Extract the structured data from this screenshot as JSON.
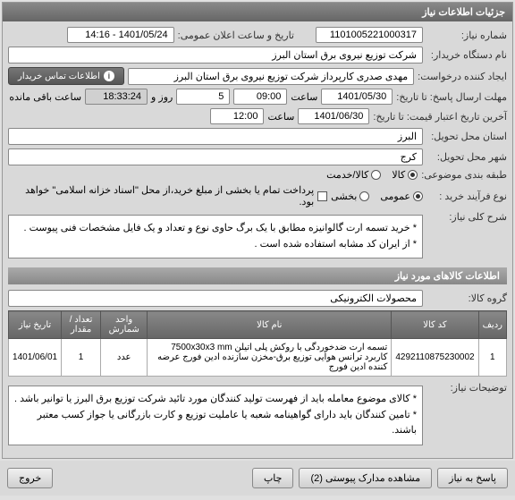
{
  "header": {
    "title": "جزئیات اطلاعات نیاز"
  },
  "fields": {
    "need_no_label": "شماره نیاز:",
    "need_no": "1101005221000317",
    "announce_label": "تاریخ و ساعت اعلان عمومی:",
    "announce_value": "1401/05/24 - 14:16",
    "buyer_label": "نام دستگاه خریدار:",
    "buyer": "شرکت توزیع نیروی برق استان البرز",
    "requester_label": "ایجاد کننده درخواست:",
    "requester": "مهدی صدری کارپرداز شرکت توزیع نیروی برق استان البرز",
    "contact_btn": "اطلاعات تماس خریدار",
    "deadline_label": "مهلت ارسال پاسخ: تا تاریخ:",
    "deadline_date": "1401/05/30",
    "time_label": "ساعت",
    "deadline_time": "09:00",
    "day_label": "روز و",
    "days_remaining": "5",
    "remaining_time": "18:33:24",
    "remaining_suffix": "ساعت باقی مانده",
    "validity_label": "آخرین تاریخ اعتبار قیمت: تا تاریخ:",
    "validity_date": "1401/06/30",
    "validity_time": "12:00",
    "province_label": "استان محل تحویل:",
    "province": "البرز",
    "city_label": "شهر محل تحویل:",
    "city": "کرج",
    "category_label": "طبقه بندی موضوعی:",
    "cat_goods": "کالا",
    "cat_service": "کالا/خدمت",
    "process_label": "نوع فرآیند خرید :",
    "proc_public": "عمومی",
    "proc_group": "بخشی",
    "payment_note": "پرداخت تمام یا بخشی از مبلغ خرید،از محل \"اسناد خزانه اسلامی\" خواهد بود.",
    "desc_label": "شرح کلی نیاز:",
    "desc_text": "* خرید تسمه ارت گالوانیزه مطابق با یک برگ حاوی نوع و تعداد و یک فایل مشخصات فنی پیوست .\n* از ایران کد مشابه استفاده شده است .",
    "items_header": "اطلاعات کالاهای مورد نیاز",
    "group_label": "گروه کالا:",
    "group_value": "محصولات الکترونیکی",
    "notes_label": "توضیحات نیاز:",
    "notes_text": "* کالای موضوع معامله باید از فهرست تولید کنندگان مورد تائید شرکت توزیع برق البرز یا توانیر باشد .\n* تامین کنندگان باید دارای گواهینامه شعبه یا عاملیت توزیع و کارت بازرگانی یا جواز کسب معتبر باشند."
  },
  "table": {
    "headers": {
      "row": "ردیف",
      "code": "کد کالا",
      "name": "نام کالا",
      "unit": "واحد شمارش",
      "qty": "تعداد / مقدار",
      "date": "تاریخ نیاز"
    },
    "rows": [
      {
        "idx": "1",
        "code": "4292110875230002",
        "name": "تسمه ارت ضدخوردگی با روکش پلی اتیلن 7500x30x3 mm کاربرد ترانس هوایی توزیع برق-مخزن سازنده ادین فورج عرضه کننده ادین فورج",
        "unit": "عدد",
        "qty": "1",
        "date": "1401/06/01"
      }
    ]
  },
  "footer": {
    "respond": "پاسخ به نیاز",
    "attachments": "مشاهده مدارک پیوستی (2)",
    "print": "چاپ",
    "exit": "خروج"
  }
}
